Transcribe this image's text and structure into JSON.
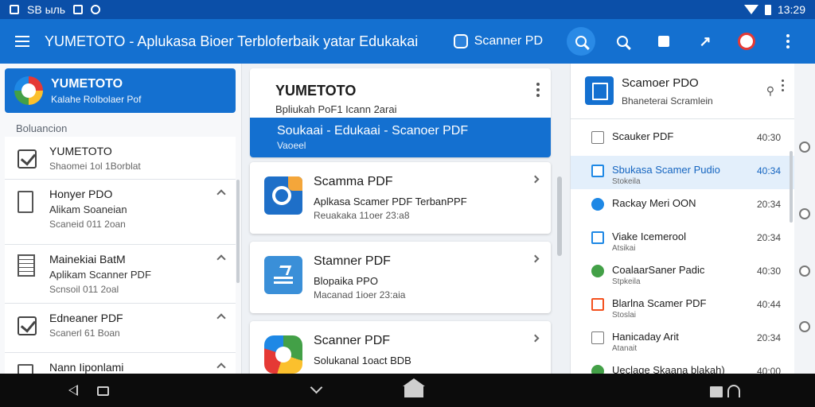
{
  "status_bar": {
    "left_text": "SB ыль",
    "time": "13:29"
  },
  "app_bar": {
    "title": "YUMETOTO - Aplukasa Bioer Terbloferbaik yatar Edukakai",
    "scanner_label": "Scanner PD"
  },
  "left_panel": {
    "hero": {
      "title": "YUMETOTO",
      "subtitle": "Kalahe Rolbolaer Pof"
    },
    "section_label": "Boluancion",
    "items": [
      {
        "title": "YUMETOTO",
        "sub": "Shaomei 1ol 1Borblat",
        "meta": ""
      },
      {
        "title": "Honyer PDO",
        "sub": "Alikam Soaneian",
        "meta": "Scaneid 011 2oan"
      },
      {
        "title": "Mainekiai BatM",
        "sub": "Aplikam Scanner PDF",
        "meta": "Scnsoil 011 2oal"
      },
      {
        "title": "Edneaner PDF",
        "sub": "Scanerl 61 Boan",
        "meta": ""
      },
      {
        "title": "Nann Iiponlami",
        "sub": "",
        "meta": ""
      }
    ]
  },
  "middle_panel": {
    "header": {
      "title": "YUMETOTO",
      "subtitle": "Bpliukah PoF1 Icann 2arai"
    },
    "banner": {
      "title": "Soukaai - Edukaai - Scanoer PDF",
      "sub": "Vaoeel"
    },
    "cards": [
      {
        "title": "Scamma PDF",
        "sub": "Aplkasa Scamer PDF TerbanPPF",
        "meta": "Reuakaka 11oer 23:a8"
      },
      {
        "title": "Stamner PDF",
        "sub": "Blopaika PPO",
        "meta": "Macanad 1ioer 23:aia"
      },
      {
        "title": "Scanner PDF",
        "sub": "Solukanal 1oact BDB",
        "meta": ""
      }
    ]
  },
  "right_panel": {
    "header": {
      "title": "Scamoer PDO",
      "subtitle": "Bhaneterai Scramlein"
    },
    "items": [
      {
        "title": "Scauker PDF",
        "sub": "",
        "time": "40:30",
        "icon": "document-icon",
        "color": "#777777"
      },
      {
        "title": "Sbukasa Scamer Pudio",
        "sub": "Stokeila",
        "time": "40:34",
        "icon": "edit-icon",
        "color": "#1e88e5",
        "selected": true
      },
      {
        "title": "Rackay Meri OON",
        "sub": "",
        "time": "20:34",
        "icon": "check-circle-icon",
        "color": "#1e88e5"
      },
      {
        "title": "Viake Icemerool",
        "sub": "Atsikai",
        "time": "20:34",
        "icon": "edit-icon",
        "color": "#1e88e5"
      },
      {
        "title": "CoalaarSaner Padic",
        "sub": "Stpkeila",
        "time": "40:30",
        "icon": "check-circle-icon",
        "color": "#43a047"
      },
      {
        "title": "Blarlna Scamer PDF",
        "sub": "Stoslai",
        "time": "40:44",
        "icon": "pdf-icon",
        "color": "#f4511e"
      },
      {
        "title": "Hanicaday Arit",
        "sub": "Atanait",
        "time": "20:34",
        "icon": "document-icon",
        "color": "#777777"
      },
      {
        "title": "Ueclage Skaana blakah)",
        "sub": "",
        "time": "40:00",
        "icon": "check-circle-icon",
        "color": "#43a047"
      }
    ]
  },
  "colors": {
    "primary": "#1470d0",
    "status_bar": "#0b4fa8",
    "nav_bar": "#0c0c0c"
  }
}
